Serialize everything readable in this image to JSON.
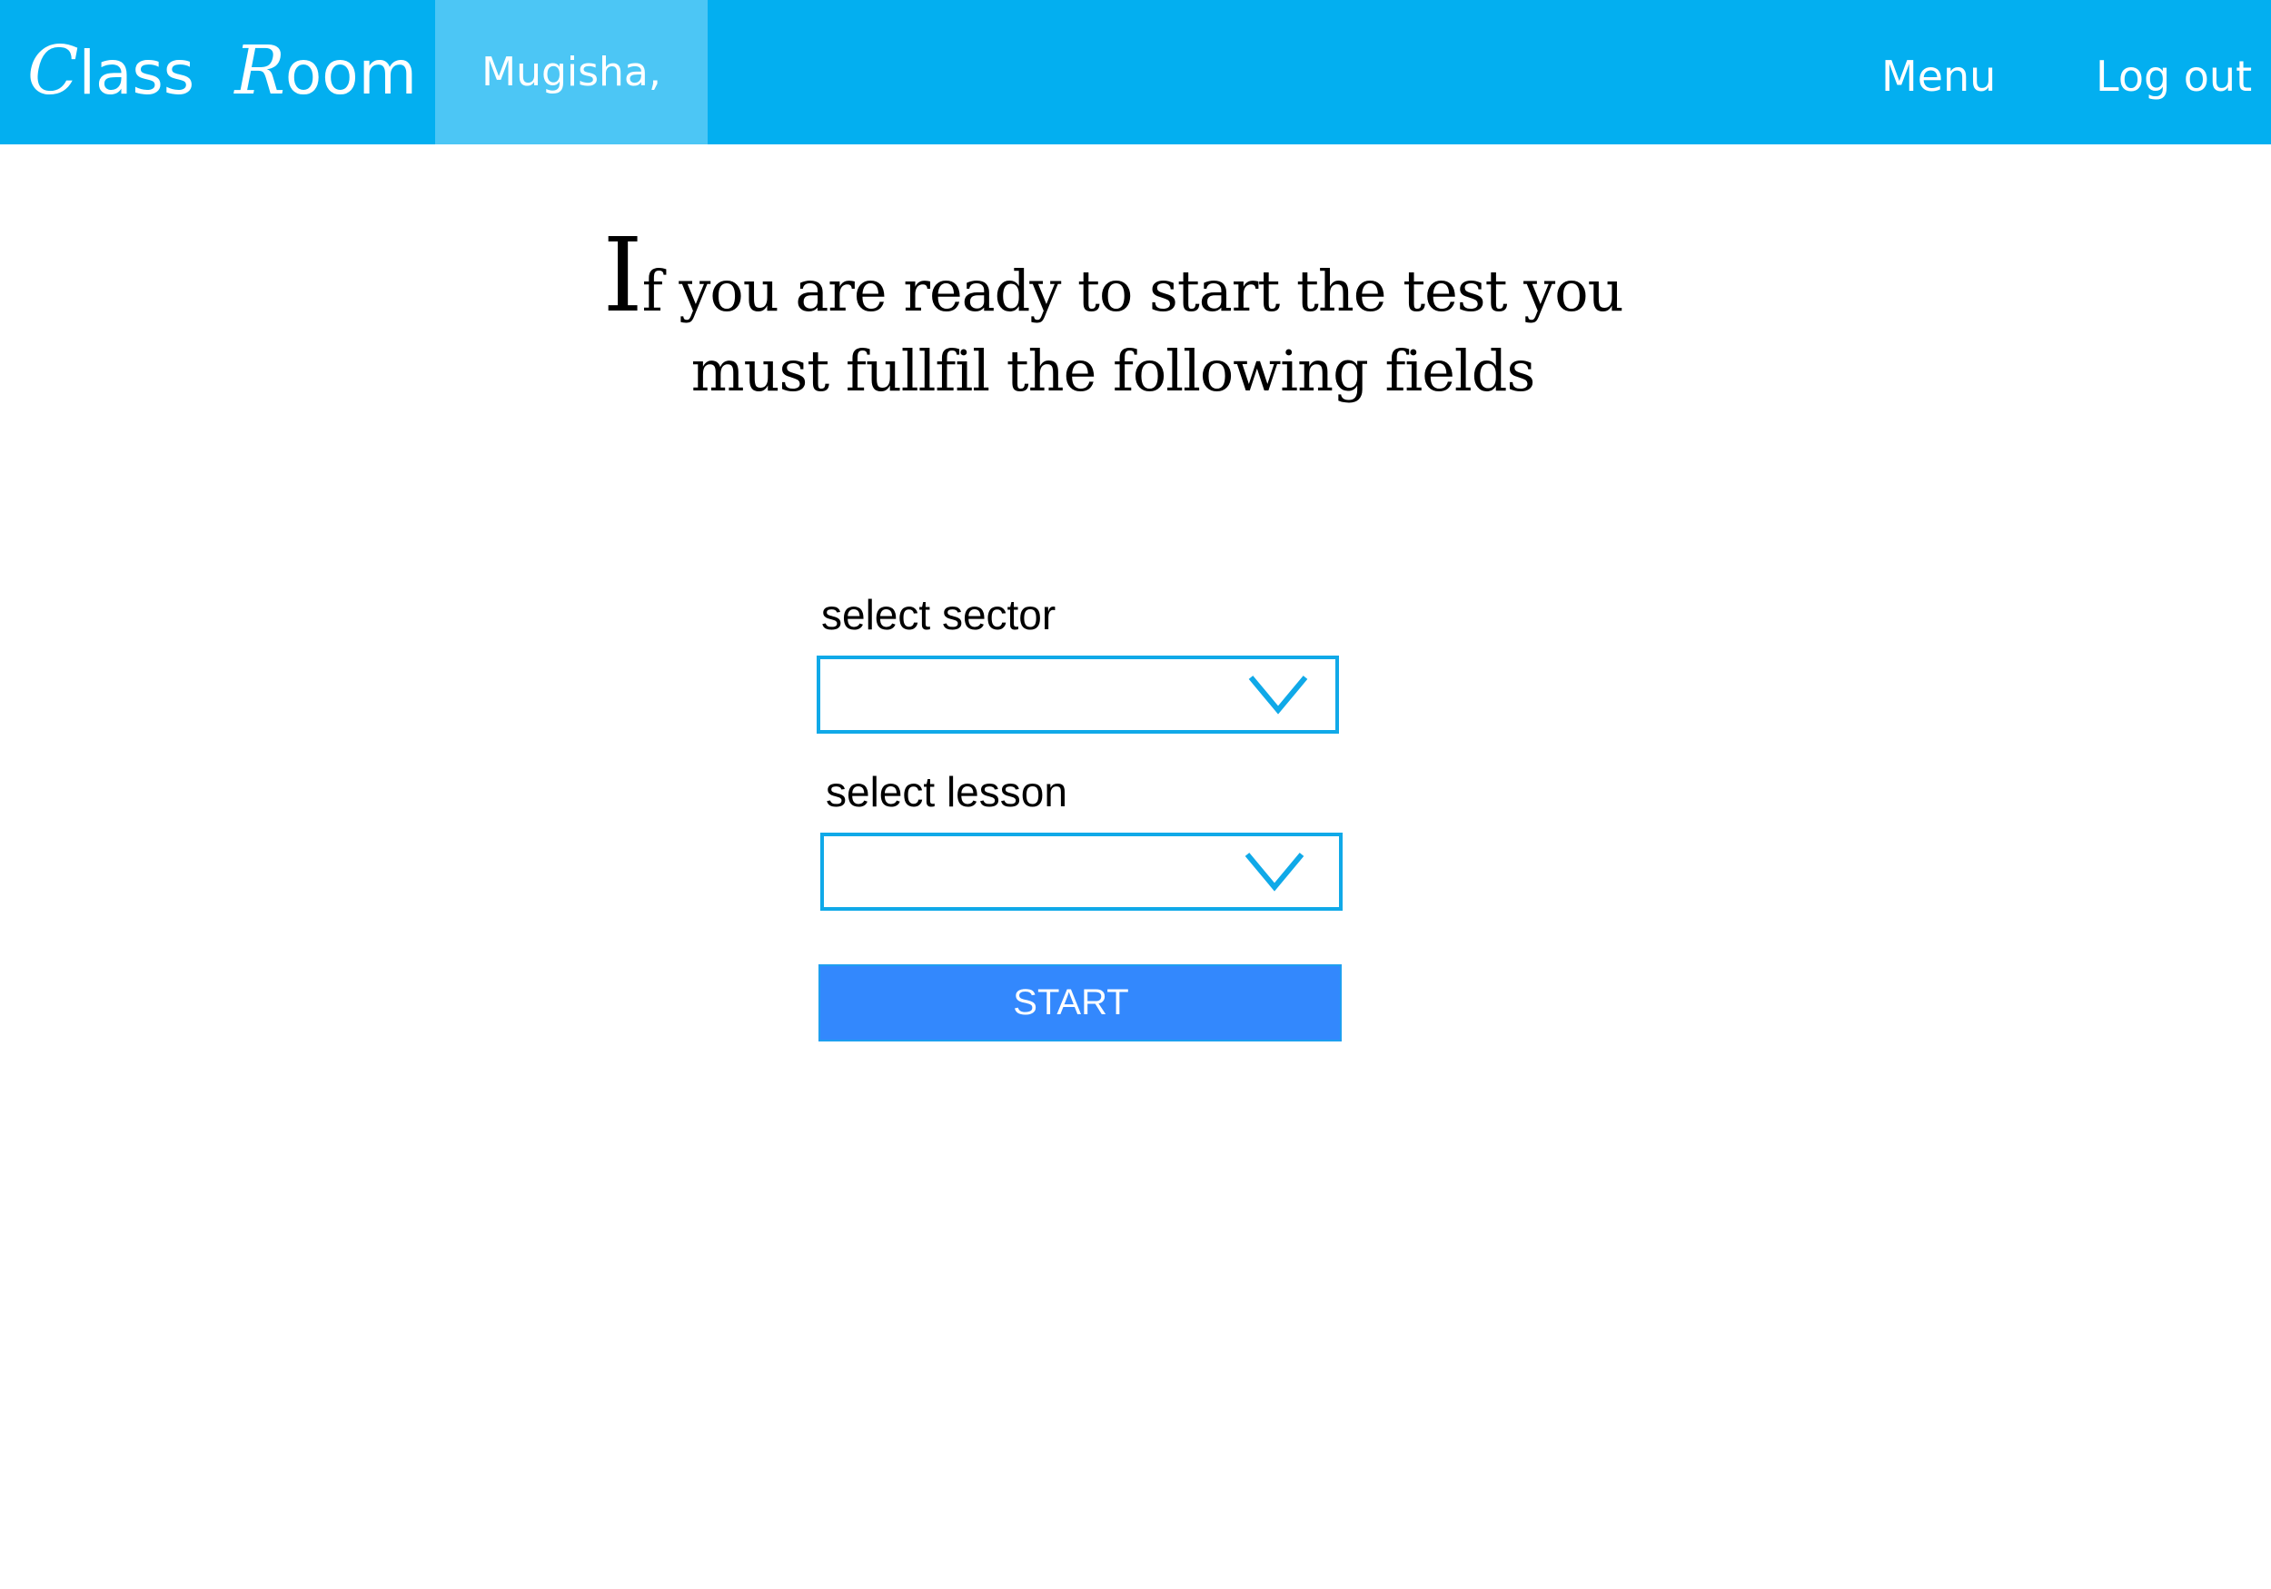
{
  "header": {
    "brand": {
      "word1_initial": "C",
      "word1_rest": "lass",
      "word2_initial": "R",
      "word2_rest": "oom"
    },
    "user_greeting": "Mugisha,",
    "menu_label": "Menu",
    "logout_label": "Log out"
  },
  "main": {
    "heading_initial": "I",
    "heading_rest_line1": "f you are ready to start the test you",
    "heading_line2": "must fullfil the following fields",
    "sector": {
      "label": "select sector",
      "value": ""
    },
    "lesson": {
      "label": "select lesson",
      "value": ""
    },
    "start_label": "START"
  },
  "colors": {
    "navbar": "#03aff0",
    "user_tab": "#4cc6f5",
    "select_border": "#10a9e8",
    "start_button": "#3388fd"
  },
  "icons": {
    "select_dropdown": "chevron-down-icon"
  }
}
